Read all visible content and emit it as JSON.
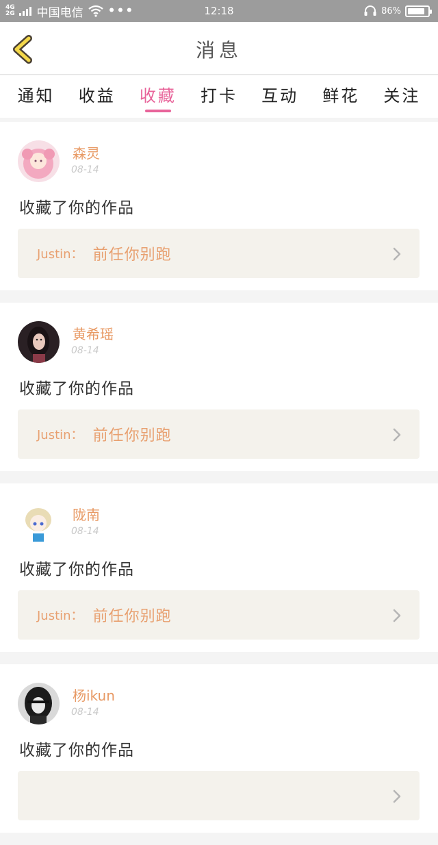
{
  "status_bar": {
    "network_top": "4G",
    "network_bottom": "2G",
    "carrier": "中国电信",
    "time": "12:18",
    "battery": "86%",
    "battery_level": 0.86
  },
  "header": {
    "title": "消息"
  },
  "tabs": [
    {
      "label": "通知"
    },
    {
      "label": "收益"
    },
    {
      "label": "收藏",
      "active": true
    },
    {
      "label": "打卡"
    },
    {
      "label": "互动"
    },
    {
      "label": "鲜花"
    },
    {
      "label": "关注"
    }
  ],
  "colors": {
    "accent": "#e8649a",
    "name": "#e89a65",
    "work": "#e8a070"
  },
  "items": [
    {
      "name": "森灵",
      "date": "08-14",
      "action": "收藏了你的作品",
      "work_author": "Justin：",
      "work_title": "前任你别跑"
    },
    {
      "name": "黄希瑶",
      "date": "08-14",
      "action": "收藏了你的作品",
      "work_author": "Justin：",
      "work_title": "前任你别跑"
    },
    {
      "name": "陇南",
      "date": "08-14",
      "action": "收藏了你的作品",
      "work_author": "Justin：",
      "work_title": "前任你别跑"
    },
    {
      "name": "杨ikun",
      "date": "08-14",
      "action": "收藏了你的作品",
      "work_author": "",
      "work_title": ""
    }
  ]
}
